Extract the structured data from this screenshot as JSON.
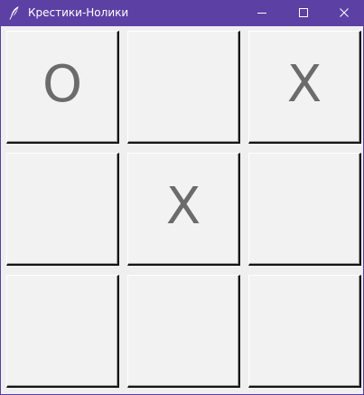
{
  "window": {
    "title": "Крестики-Нолики",
    "title_bar_color": "#5c40a3",
    "icon": "feather-icon"
  },
  "controls": {
    "minimize_icon": "minimize-icon",
    "maximize_icon": "maximize-icon",
    "close_icon": "close-icon"
  },
  "board": {
    "mark_color": "#6b6b6b",
    "cells": [
      [
        "O",
        "",
        "X"
      ],
      [
        "",
        "X",
        ""
      ],
      [
        "",
        "",
        ""
      ]
    ]
  }
}
